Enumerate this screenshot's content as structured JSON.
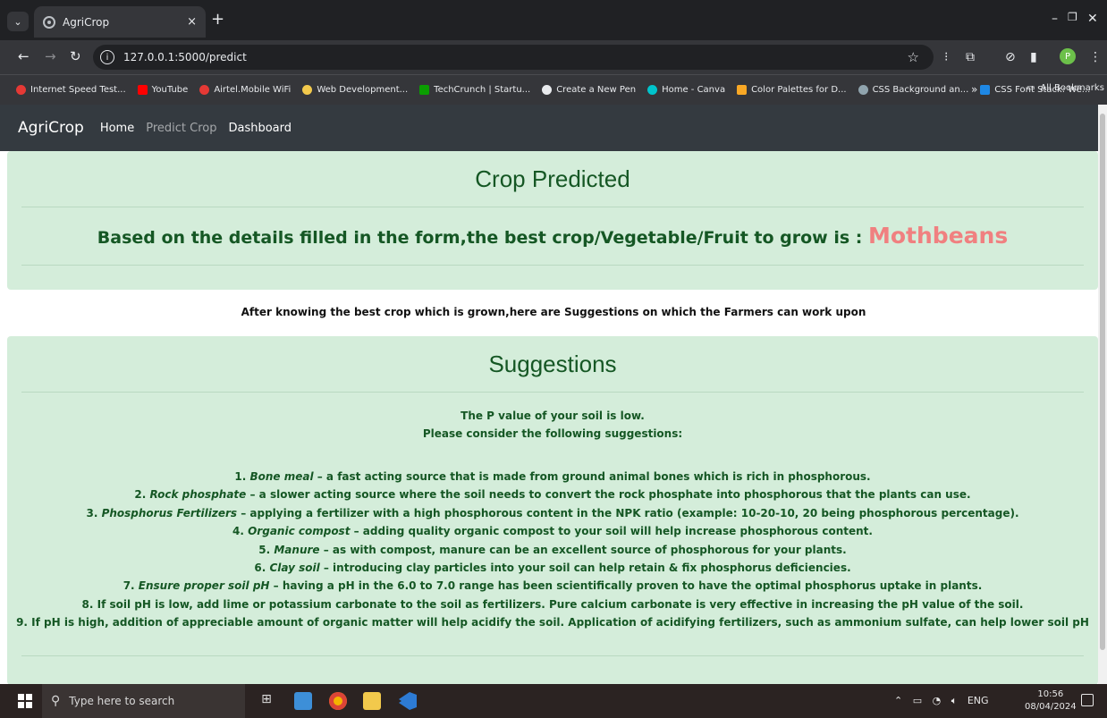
{
  "browser": {
    "tab_title": "AgriCrop",
    "tab_close": "×",
    "new_tab": "+",
    "url": "127.0.0.1:5000/predict",
    "bookmarks": [
      {
        "label": "Internet Speed Test...",
        "color": "#e53935"
      },
      {
        "label": "YouTube",
        "color": "#ff0000"
      },
      {
        "label": "Airtel.Mobile WiFi",
        "color": "#e53935"
      },
      {
        "label": "Web Development...",
        "color": "#f2c94c"
      },
      {
        "label": "TechCrunch | Startu...",
        "color": "#0a9e01"
      },
      {
        "label": "Create a New Pen",
        "color": "#e8eaed"
      },
      {
        "label": "Home - Canva",
        "color": "#00c4cc"
      },
      {
        "label": "Color Palettes for D...",
        "color": "#f9a825"
      },
      {
        "label": "CSS Background an...",
        "color": "#90a4ae"
      },
      {
        "label": "CSS Font Stack: We...",
        "color": "#1e88e5"
      }
    ],
    "bookmarks_more": "»",
    "all_bookmarks": "All Bookmarks",
    "profile_initial": "P"
  },
  "site": {
    "brand": "AgriCrop",
    "nav": [
      "Home",
      "Predict Crop",
      "Dashboard"
    ]
  },
  "prediction": {
    "heading": "Crop Predicted",
    "result_text": "Based on the details filled in the form,the best crop/Vegetable/Fruit to grow is : ",
    "crop": "Mothbeans"
  },
  "between_text": "After knowing the best crop which is grown,here are Suggestions on which the Farmers can work upon",
  "suggestions": {
    "heading": "Suggestions",
    "line1": "The P value of your soil is low.",
    "line2": "Please consider the following suggestions:",
    "items": [
      {
        "num": "1. ",
        "term": "Bone meal",
        "text": " – a fast acting source that is made from ground animal bones which is rich in phosphorous."
      },
      {
        "num": "2. ",
        "term": "Rock phosphate",
        "text": " – a slower acting source where the soil needs to convert the rock phosphate into phosphorous that the plants can use."
      },
      {
        "num": "3. ",
        "term": "Phosphorus Fertilizers",
        "text": " – applying a fertilizer with a high phosphorous content in the NPK ratio (example: 10-20-10, 20 being phosphorous percentage)."
      },
      {
        "num": "4. ",
        "term": "Organic compost",
        "text": " – adding quality organic compost to your soil will help increase phosphorous content."
      },
      {
        "num": "5. ",
        "term": "Manure",
        "text": " – as with compost, manure can be an excellent source of phosphorous for your plants."
      },
      {
        "num": "6. ",
        "term": "Clay soil",
        "text": " – introducing clay particles into your soil can help retain & fix phosphorus deficiencies."
      },
      {
        "num": "7. ",
        "term": "Ensure proper soil pH",
        "text": " – having a pH in the 6.0 to 7.0 range has been scientifically proven to have the optimal phosphorus uptake in plants."
      },
      {
        "num": "8. ",
        "term": "",
        "text": "If soil pH is low, add lime or potassium carbonate to the soil as fertilizers. Pure calcium carbonate is very effective in increasing the pH value of the soil."
      },
      {
        "num": "9. ",
        "term": "",
        "text": "If pH is high, addition of appreciable amount of organic matter will help acidify the soil. Application of acidifying fertilizers, such as ammonium sulfate, can help lower soil pH"
      }
    ]
  },
  "taskbar": {
    "search_placeholder": "Type here to search",
    "tray_lang": "ENG",
    "time": "10:56",
    "date": "08/04/2024"
  },
  "colors": {
    "navbar": "#343a40",
    "jumbotron": "#d4edda",
    "text_green": "#155724",
    "crop_highlight": "#f08080"
  }
}
